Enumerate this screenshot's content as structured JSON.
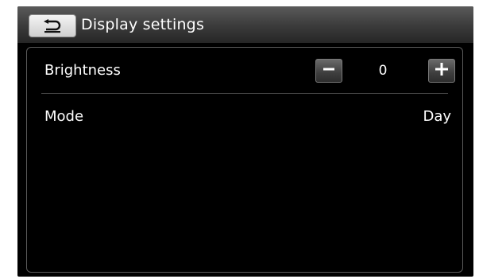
{
  "title_bar": {
    "title": "Display settings",
    "back_icon": "back-arrow-icon"
  },
  "settings": {
    "brightness": {
      "label": "Brightness",
      "value": "0",
      "decrease_icon": "minus-icon",
      "increase_icon": "plus-icon"
    },
    "mode": {
      "label": "Mode",
      "value": "Day"
    }
  }
}
